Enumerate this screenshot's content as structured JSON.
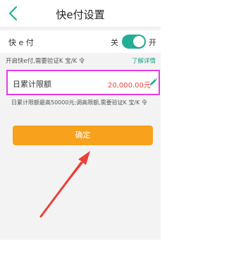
{
  "header": {
    "title": "快e付设置",
    "back_icon": "chevron-left-icon"
  },
  "toggle_row": {
    "label": "快 e 付",
    "off_label": "关",
    "on_label": "开",
    "enabled": true
  },
  "info": {
    "text": "开启快e付,需要验证K 宝/K 令",
    "link": "了解详情"
  },
  "limit": {
    "label": "日累计限额",
    "amount": "20,000.00元",
    "edit_icon": "pencil-icon"
  },
  "note": "日累计限额最高50000元;调高限额,需要验证K 宝/K 令",
  "confirm_button": "确定",
  "colors": {
    "accent_green": "#23ae95",
    "link_green": "#1a9f89",
    "amount_red": "#e8433a",
    "button_orange": "#f7a11c",
    "highlight_magenta": "#e43ce5",
    "arrow_red": "#e8433a"
  }
}
